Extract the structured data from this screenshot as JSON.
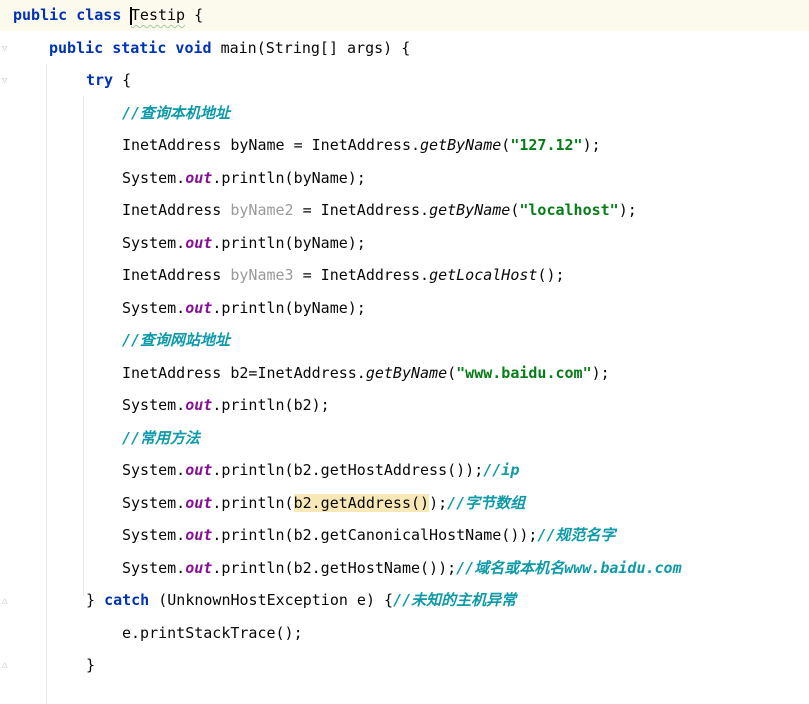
{
  "editor": {
    "language": "Java",
    "colors": {
      "background": "#ffffff",
      "current_line": "#fcfaed",
      "keyword": "#0033b3",
      "string": "#067d17",
      "comment": "#0e9aa8",
      "static_field": "#871094",
      "unused_variable": "#9a9a9a",
      "match_highlight": "#f8e8b8"
    },
    "lines": [
      {
        "indent": 0,
        "current": true,
        "tokens": [
          {
            "t": "public class ",
            "c": "kw"
          },
          {
            "t": "Testip",
            "c": "typo",
            "caret": true
          },
          {
            "t": " {",
            "c": ""
          }
        ]
      },
      {
        "indent": 1,
        "tokens": [
          {
            "t": "public static void ",
            "c": "kw"
          },
          {
            "t": "main(String[] args) {",
            "c": ""
          }
        ]
      },
      {
        "indent": 2,
        "tokens": [
          {
            "t": "try",
            "c": "kw"
          },
          {
            "t": " {",
            "c": ""
          }
        ]
      },
      {
        "indent": 3,
        "tokens": [
          {
            "t": "//查询本机地址",
            "c": "cm-doc"
          }
        ]
      },
      {
        "indent": 3,
        "tokens": [
          {
            "t": "InetAddress byName = InetAddress.",
            "c": ""
          },
          {
            "t": "getByName",
            "c": "mth"
          },
          {
            "t": "(",
            "c": ""
          },
          {
            "t": "\"127.12\"",
            "c": "str"
          },
          {
            "t": ");",
            "c": ""
          }
        ]
      },
      {
        "indent": 3,
        "tokens": [
          {
            "t": "System.",
            "c": ""
          },
          {
            "t": "out",
            "c": "fld"
          },
          {
            "t": ".println(byName);",
            "c": ""
          }
        ]
      },
      {
        "indent": 3,
        "tokens": [
          {
            "t": "InetAddress ",
            "c": ""
          },
          {
            "t": "byName2",
            "c": "unused"
          },
          {
            "t": " = InetAddress.",
            "c": ""
          },
          {
            "t": "getByName",
            "c": "mth"
          },
          {
            "t": "(",
            "c": ""
          },
          {
            "t": "\"localhost\"",
            "c": "str"
          },
          {
            "t": ");",
            "c": ""
          }
        ]
      },
      {
        "indent": 3,
        "tokens": [
          {
            "t": "System.",
            "c": ""
          },
          {
            "t": "out",
            "c": "fld"
          },
          {
            "t": ".println(byName);",
            "c": ""
          }
        ]
      },
      {
        "indent": 3,
        "tokens": [
          {
            "t": "InetAddress ",
            "c": ""
          },
          {
            "t": "byName3",
            "c": "unused"
          },
          {
            "t": " = InetAddress.",
            "c": ""
          },
          {
            "t": "getLocalHost",
            "c": "mth"
          },
          {
            "t": "();",
            "c": ""
          }
        ]
      },
      {
        "indent": 3,
        "tokens": [
          {
            "t": "System.",
            "c": ""
          },
          {
            "t": "out",
            "c": "fld"
          },
          {
            "t": ".println(byName);",
            "c": ""
          }
        ]
      },
      {
        "indent": 3,
        "tokens": [
          {
            "t": "//查询网站地址",
            "c": "cm-doc"
          }
        ]
      },
      {
        "indent": 3,
        "tokens": [
          {
            "t": "InetAddress b2=InetAddress.",
            "c": ""
          },
          {
            "t": "getByName",
            "c": "mth"
          },
          {
            "t": "(",
            "c": ""
          },
          {
            "t": "\"www.baidu.com\"",
            "c": "str"
          },
          {
            "t": ");",
            "c": ""
          }
        ]
      },
      {
        "indent": 3,
        "tokens": [
          {
            "t": "System.",
            "c": ""
          },
          {
            "t": "out",
            "c": "fld"
          },
          {
            "t": ".println(b2);",
            "c": ""
          }
        ]
      },
      {
        "indent": 3,
        "tokens": [
          {
            "t": "//常用方法",
            "c": "cm-doc"
          }
        ]
      },
      {
        "indent": 3,
        "tokens": [
          {
            "t": "System.",
            "c": ""
          },
          {
            "t": "out",
            "c": "fld"
          },
          {
            "t": ".println(b2.getHostAddress());",
            "c": ""
          },
          {
            "t": "//ip",
            "c": "cm-doc"
          }
        ]
      },
      {
        "indent": 3,
        "tokens": [
          {
            "t": "System.",
            "c": ""
          },
          {
            "t": "out",
            "c": "fld"
          },
          {
            "t": ".println(",
            "c": ""
          },
          {
            "t": "b2.getAddress()",
            "c": "hl"
          },
          {
            "t": ");",
            "c": ""
          },
          {
            "t": "//字节数组",
            "c": "cm-doc"
          }
        ]
      },
      {
        "indent": 3,
        "tokens": [
          {
            "t": "System.",
            "c": ""
          },
          {
            "t": "out",
            "c": "fld"
          },
          {
            "t": ".println(b2.getCanonicalHostName());",
            "c": ""
          },
          {
            "t": "//规范名字",
            "c": "cm-doc"
          }
        ]
      },
      {
        "indent": 3,
        "tokens": [
          {
            "t": "System.",
            "c": ""
          },
          {
            "t": "out",
            "c": "fld"
          },
          {
            "t": ".println(b2.getHostName());",
            "c": ""
          },
          {
            "t": "//域名或本机名www.baidu.com",
            "c": "cm-doc"
          }
        ]
      },
      {
        "indent": 2,
        "tokens": [
          {
            "t": "} ",
            "c": ""
          },
          {
            "t": "catch",
            "c": "kw"
          },
          {
            "t": " (UnknownHostException e) {",
            "c": ""
          },
          {
            "t": "//未知的主机异常",
            "c": "cm-doc"
          }
        ]
      },
      {
        "indent": 3,
        "tokens": [
          {
            "t": "e.printStackTrace();",
            "c": ""
          }
        ]
      },
      {
        "indent": 2,
        "tokens": [
          {
            "t": "}",
            "c": ""
          }
        ]
      }
    ]
  }
}
